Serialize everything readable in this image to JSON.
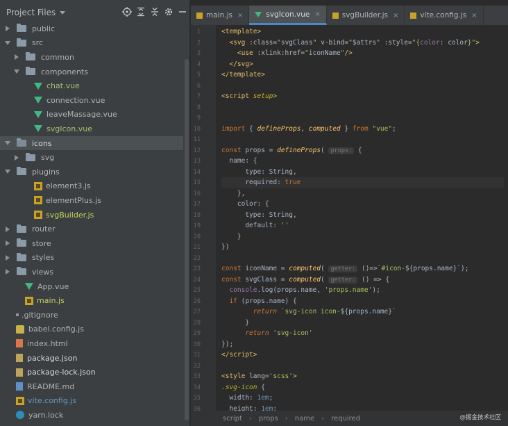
{
  "sidebar": {
    "title": "Project Files",
    "tree": [
      {
        "label": "public",
        "type": "folder",
        "arrow": "right",
        "indent": 0,
        "style": "plain"
      },
      {
        "label": "src",
        "type": "folder",
        "arrow": "down",
        "indent": 0,
        "style": "plain"
      },
      {
        "label": "common",
        "type": "folder",
        "arrow": "right",
        "indent": 1,
        "style": "plain"
      },
      {
        "label": "components",
        "type": "folder",
        "arrow": "down",
        "indent": 1,
        "style": "plain"
      },
      {
        "label": "chat.vue",
        "type": "vue",
        "indent": 2,
        "style": "active-file"
      },
      {
        "label": "connection.vue",
        "type": "vue",
        "indent": 2,
        "style": "plain"
      },
      {
        "label": "leaveMassage.vue",
        "type": "vue",
        "indent": 2,
        "style": "plain"
      },
      {
        "label": "svgIcon.vue",
        "type": "vue",
        "indent": 2,
        "style": "active-file"
      },
      {
        "label": "icons",
        "type": "folder",
        "arrow": "down",
        "indent": 0,
        "style": "white",
        "selected": true
      },
      {
        "label": "svg",
        "type": "folder",
        "arrow": "right",
        "indent": 1,
        "style": "plain"
      },
      {
        "label": "plugins",
        "type": "folder",
        "arrow": "down",
        "indent": 0,
        "style": "plain"
      },
      {
        "label": "element3.js",
        "type": "js",
        "indent": 2,
        "style": "plain"
      },
      {
        "label": "elementPlus.js",
        "type": "js",
        "indent": 2,
        "style": "plain"
      },
      {
        "label": "svgBuilder.js",
        "type": "js",
        "indent": 2,
        "style": "js-name"
      },
      {
        "label": "router",
        "type": "folder",
        "arrow": "right",
        "indent": 0,
        "style": "plain"
      },
      {
        "label": "store",
        "type": "folder",
        "arrow": "right",
        "indent": 0,
        "style": "plain"
      },
      {
        "label": "styles",
        "type": "folder",
        "arrow": "right",
        "indent": 0,
        "style": "plain"
      },
      {
        "label": "views",
        "type": "folder",
        "arrow": "right",
        "indent": 0,
        "style": "plain"
      },
      {
        "label": "App.vue",
        "type": "vue",
        "indent": 1,
        "style": "plain"
      },
      {
        "label": "main.js",
        "type": "js",
        "indent": 1,
        "style": "js-name"
      },
      {
        "label": ".gitignore",
        "type": "git",
        "indent": 0,
        "style": "plain"
      },
      {
        "label": "babel.config.js",
        "type": "babel",
        "indent": 0,
        "style": "plain"
      },
      {
        "label": "index.html",
        "type": "html",
        "indent": 0,
        "style": "plain"
      },
      {
        "label": "package.json",
        "type": "json",
        "indent": 0,
        "style": "white"
      },
      {
        "label": "package-lock.json",
        "type": "json",
        "indent": 0,
        "style": "white"
      },
      {
        "label": "README.md",
        "type": "md",
        "indent": 0,
        "style": "plain"
      },
      {
        "label": "vite.config.js",
        "type": "js",
        "indent": 0,
        "style": "blue"
      },
      {
        "label": "yarn.lock",
        "type": "yarn",
        "indent": 0,
        "style": "plain"
      }
    ]
  },
  "tabs": [
    {
      "label": "main.js",
      "icon": "js",
      "active": false
    },
    {
      "label": "svgIcon.vue",
      "icon": "vue",
      "active": true
    },
    {
      "label": "svgBuilder.js",
      "icon": "js",
      "active": false
    },
    {
      "label": "vite.config.js",
      "icon": "js",
      "active": false
    }
  ],
  "tab_close_glyph": "×",
  "code_lines": [
    [
      {
        "t": "<",
        "c": "ang"
      },
      {
        "t": "template",
        "c": "tag"
      },
      {
        "t": ">",
        "c": "ang"
      }
    ],
    [
      {
        "t": "  <",
        "c": "ang"
      },
      {
        "t": "svg",
        "c": "tag"
      },
      {
        "t": " :class=",
        "c": "attr"
      },
      {
        "t": "\"",
        "c": "str"
      },
      {
        "t": "svgClass",
        "c": "plain"
      },
      {
        "t": "\"",
        "c": "str"
      },
      {
        "t": " v-bind=",
        "c": "attr"
      },
      {
        "t": "\"",
        "c": "str"
      },
      {
        "t": "$attrs",
        "c": "plain"
      },
      {
        "t": "\"",
        "c": "str"
      },
      {
        "t": " :style=",
        "c": "attr"
      },
      {
        "t": "\"{",
        "c": "str"
      },
      {
        "t": "color",
        "c": "prop"
      },
      {
        "t": ": ",
        "c": "plain"
      },
      {
        "t": "color",
        "c": "plain"
      },
      {
        "t": "}\"",
        "c": "str"
      },
      {
        "t": ">",
        "c": "ang"
      }
    ],
    [
      {
        "t": "    <",
        "c": "ang"
      },
      {
        "t": "use",
        "c": "tag"
      },
      {
        "t": " :xlink:href=",
        "c": "attr"
      },
      {
        "t": "\"",
        "c": "str"
      },
      {
        "t": "iconName",
        "c": "plain"
      },
      {
        "t": "\"",
        "c": "str"
      },
      {
        "t": "/>",
        "c": "ang"
      }
    ],
    [
      {
        "t": "  </",
        "c": "ang"
      },
      {
        "t": "svg",
        "c": "tag"
      },
      {
        "t": ">",
        "c": "ang"
      }
    ],
    [
      {
        "t": "</",
        "c": "ang"
      },
      {
        "t": "template",
        "c": "tag"
      },
      {
        "t": ">",
        "c": "ang"
      }
    ],
    [],
    [
      {
        "t": "<",
        "c": "ang"
      },
      {
        "t": "script",
        "c": "tag"
      },
      {
        "t": " setup",
        "c": "it"
      },
      {
        "t": ">",
        "c": "ang"
      }
    ],
    [],
    [],
    [
      {
        "t": "import",
        "c": "kw"
      },
      {
        "t": " { ",
        "c": "plain"
      },
      {
        "t": "defineProps",
        "c": "fn"
      },
      {
        "t": ", ",
        "c": "plain"
      },
      {
        "t": "computed",
        "c": "fn"
      },
      {
        "t": " } ",
        "c": "plain"
      },
      {
        "t": "from",
        "c": "kw"
      },
      {
        "t": " \"vue\"",
        "c": "str"
      },
      {
        "t": ";",
        "c": "plain"
      }
    ],
    [],
    [
      {
        "t": "const",
        "c": "kw"
      },
      {
        "t": " props = ",
        "c": "plain"
      },
      {
        "t": "defineProps",
        "c": "fn"
      },
      {
        "t": "( ",
        "c": "plain"
      },
      {
        "t": "props:",
        "c": "hint"
      },
      {
        "t": " {",
        "c": "plain"
      }
    ],
    [
      {
        "t": "  name: {",
        "c": "plain"
      }
    ],
    [
      {
        "t": "      type: String,",
        "c": "plain"
      }
    ],
    [
      {
        "t": "      required: ",
        "c": "plain"
      },
      {
        "t": "true",
        "c": "bool"
      }
    ],
    [
      {
        "t": "    },",
        "c": "plain"
      }
    ],
    [
      {
        "t": "    color: {",
        "c": "plain"
      }
    ],
    [
      {
        "t": "      type: String,",
        "c": "plain"
      }
    ],
    [
      {
        "t": "      default: ",
        "c": "plain"
      },
      {
        "t": "''",
        "c": "str"
      }
    ],
    [
      {
        "t": "    }",
        "c": "plain"
      }
    ],
    [
      {
        "t": "})",
        "c": "plain"
      }
    ],
    [],
    [
      {
        "t": "const",
        "c": "kw"
      },
      {
        "t": " iconName = ",
        "c": "plain"
      },
      {
        "t": "computed",
        "c": "fn"
      },
      {
        "t": "( ",
        "c": "plain"
      },
      {
        "t": "getter:",
        "c": "hint"
      },
      {
        "t": " ()=>`",
        "c": "plain"
      },
      {
        "t": "#icon-",
        "c": "str"
      },
      {
        "t": "${props.name}",
        "c": "plain"
      },
      {
        "t": "`);",
        "c": "plain"
      }
    ],
    [
      {
        "t": "const",
        "c": "kw"
      },
      {
        "t": " svgClass = ",
        "c": "plain"
      },
      {
        "t": "computed",
        "c": "fn"
      },
      {
        "t": "( ",
        "c": "plain"
      },
      {
        "t": "getter:",
        "c": "hint"
      },
      {
        "t": " () => {",
        "c": "plain"
      }
    ],
    [
      {
        "t": "  console",
        "c": "prop"
      },
      {
        "t": ".log(props.name, ",
        "c": "plain"
      },
      {
        "t": "'props.name'",
        "c": "str"
      },
      {
        "t": ");",
        "c": "plain"
      }
    ],
    [
      {
        "t": "  ",
        "c": "plain"
      },
      {
        "t": "if",
        "c": "kw"
      },
      {
        "t": " (props.name) {",
        "c": "plain"
      }
    ],
    [
      {
        "t": "        ",
        "c": "plain"
      },
      {
        "t": "return",
        "c": "ret"
      },
      {
        "t": " `",
        "c": "plain"
      },
      {
        "t": "svg-icon icon-",
        "c": "str"
      },
      {
        "t": "${props.name}",
        "c": "plain"
      },
      {
        "t": "`",
        "c": "plain"
      }
    ],
    [
      {
        "t": "      }",
        "c": "plain"
      }
    ],
    [
      {
        "t": "      ",
        "c": "plain"
      },
      {
        "t": "return",
        "c": "ret"
      },
      {
        "t": " 'svg-icon'",
        "c": "str"
      }
    ],
    [
      {
        "t": "});",
        "c": "plain"
      }
    ],
    [
      {
        "t": "</",
        "c": "ang"
      },
      {
        "t": "script",
        "c": "tag"
      },
      {
        "t": ">",
        "c": "ang"
      }
    ],
    [],
    [
      {
        "t": "<",
        "c": "ang"
      },
      {
        "t": "style",
        "c": "tag"
      },
      {
        "t": " lang=",
        "c": "attr"
      },
      {
        "t": "'scss'",
        "c": "str"
      },
      {
        "t": ">",
        "c": "ang"
      }
    ],
    [
      {
        "t": ".svg-icon",
        "c": "it"
      },
      {
        "t": " {",
        "c": "plain"
      }
    ],
    [
      {
        "t": "  width: ",
        "c": "plain"
      },
      {
        "t": "1em",
        "c": "num"
      },
      {
        "t": ";",
        "c": "plain"
      }
    ],
    [
      {
        "t": "  height: ",
        "c": "plain"
      },
      {
        "t": "1em",
        "c": "num"
      },
      {
        "t": ";",
        "c": "plain"
      }
    ]
  ],
  "current_line": 15,
  "first_line_number": 1,
  "breadcrumb": [
    "script",
    "props",
    "name",
    "required"
  ],
  "watermark": "@掘金技术社区"
}
